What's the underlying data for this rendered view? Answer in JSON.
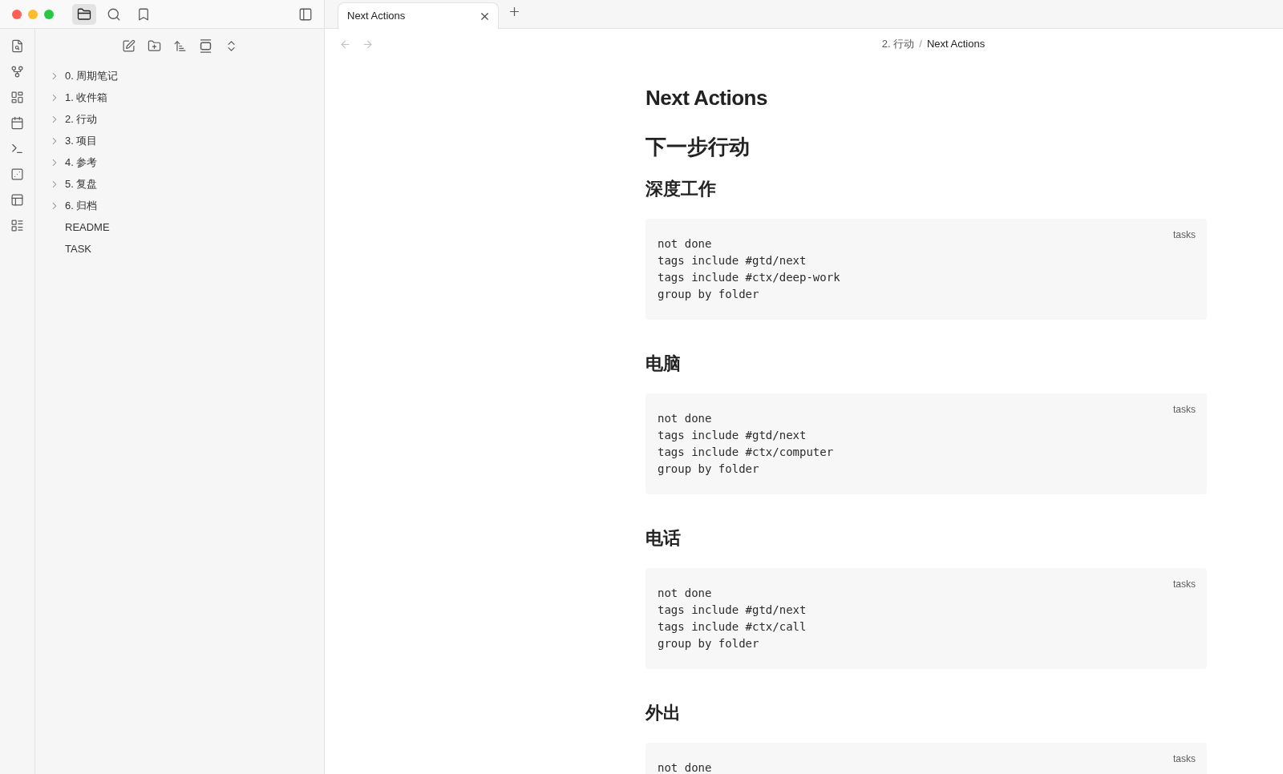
{
  "sidebar_tabs": [
    {
      "selected": true
    },
    {
      "selected": false
    },
    {
      "selected": false
    }
  ],
  "file_tree": {
    "items": [
      {
        "label": "0. 周期笔记",
        "kind": "folder",
        "expanded": false
      },
      {
        "label": "1. 收件箱",
        "kind": "folder",
        "expanded": false
      },
      {
        "label": "2. 行动",
        "kind": "folder",
        "expanded": false
      },
      {
        "label": "3. 项目",
        "kind": "folder",
        "expanded": false
      },
      {
        "label": "4. 参考",
        "kind": "folder",
        "expanded": false
      },
      {
        "label": "5. 复盘",
        "kind": "folder",
        "expanded": false
      },
      {
        "label": "6. 归档",
        "kind": "folder",
        "expanded": false
      },
      {
        "label": "README",
        "kind": "file"
      },
      {
        "label": "TASK",
        "kind": "file"
      }
    ]
  },
  "tabs": [
    {
      "label": "Next Actions",
      "selected": true
    }
  ],
  "navigation": {
    "back": {
      "disabled": true
    },
    "forward": {
      "disabled": true
    }
  },
  "breadcrumb": {
    "items": [
      "2. 行动",
      "Next Actions"
    ],
    "separator": "/"
  },
  "note": {
    "title": "Next Actions",
    "blocks": [
      {
        "kind": "heading1",
        "text": "下一步行动"
      },
      {
        "kind": "heading2",
        "text": "深度工作"
      },
      {
        "kind": "code",
        "language": "tasks",
        "lines": [
          "not done",
          "tags include #gtd/next",
          "tags include #ctx/deep-work",
          "group by folder"
        ]
      },
      {
        "kind": "heading2",
        "text": "电脑"
      },
      {
        "kind": "code",
        "language": "tasks",
        "lines": [
          "not done",
          "tags include #gtd/next",
          "tags include #ctx/computer",
          "group by folder"
        ]
      },
      {
        "kind": "heading2",
        "text": "电话"
      },
      {
        "kind": "code",
        "language": "tasks",
        "lines": [
          "not done",
          "tags include #gtd/next",
          "tags include #ctx/call",
          "group by folder"
        ]
      },
      {
        "kind": "heading2",
        "text": "外出"
      },
      {
        "kind": "code",
        "language": "tasks",
        "lines": [
          "not done"
        ]
      }
    ]
  }
}
